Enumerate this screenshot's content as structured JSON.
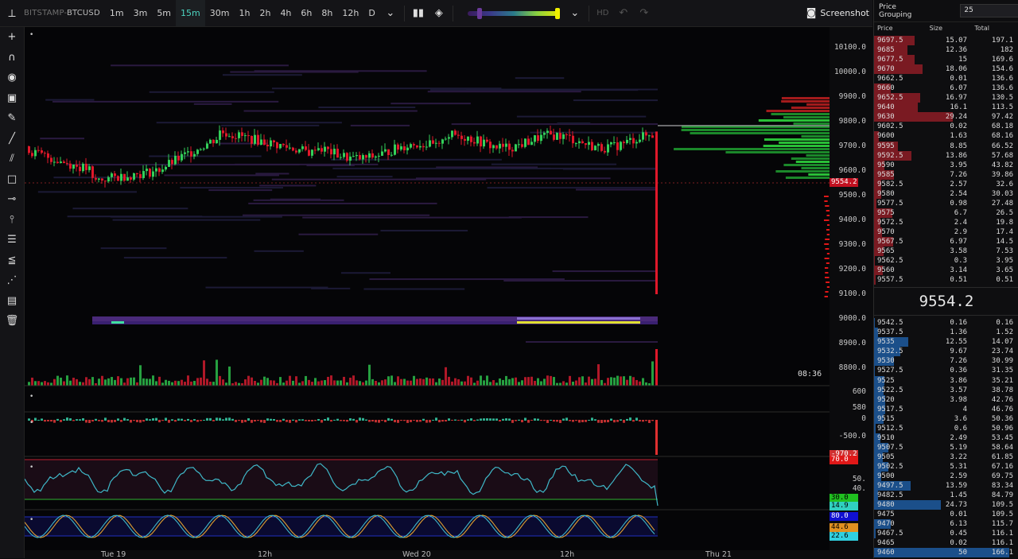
{
  "topbar": {
    "exchange": "BITSTAMP-",
    "pair": "BTCUSD",
    "timeframes": [
      "1m",
      "3m",
      "5m",
      "15m",
      "30m",
      "1h",
      "2h",
      "4h",
      "6h",
      "8h",
      "12h",
      "D"
    ],
    "active_timeframe": "15m",
    "hd_label": "HD",
    "screenshot_label": "Screenshot"
  },
  "price_axis": {
    "labels": [
      "10100.0",
      "10000.0",
      "9900.0",
      "9800.0",
      "9700.0",
      "9600.0",
      "9500.0",
      "9400.0",
      "9300.0",
      "9200.0",
      "9100.0",
      "9000.0",
      "8900.0",
      "8800.0"
    ],
    "current_price_tag": "9554.2"
  },
  "volume_axis": {
    "labels": [
      "600",
      "580"
    ]
  },
  "delta_axis": {
    "labels": [
      "0",
      "-500.0"
    ],
    "tag": "-970.2"
  },
  "rsi": {
    "labels": [
      "50.",
      "40."
    ],
    "upper": "70.0",
    "lower": "30.0",
    "value": "14.9"
  },
  "stoch": {
    "upper": "80.0",
    "k": "44.6",
    "d": "22.6"
  },
  "countdown": "08:36",
  "time_axis": [
    "Tue 19",
    "12h",
    "Wed 20",
    "12h",
    "Thu 21"
  ],
  "orderbook": {
    "grouping_label": "Price Grouping",
    "grouping_value": "25",
    "columns": [
      "Price",
      "Size",
      "Total"
    ],
    "mid_price": "9554.2",
    "asks": [
      {
        "price": "9697.5",
        "size": "15.07",
        "total": "197.1"
      },
      {
        "price": "9685",
        "size": "12.36",
        "total": "182"
      },
      {
        "price": "9677.5",
        "size": "15",
        "total": "169.6"
      },
      {
        "price": "9670",
        "size": "18.06",
        "total": "154.6"
      },
      {
        "price": "9662.5",
        "size": "0.01",
        "total": "136.6"
      },
      {
        "price": "9660",
        "size": "6.07",
        "total": "136.6"
      },
      {
        "price": "9652.5",
        "size": "16.97",
        "total": "130.5"
      },
      {
        "price": "9640",
        "size": "16.1",
        "total": "113.5"
      },
      {
        "price": "9630",
        "size": "29.24",
        "total": "97.42"
      },
      {
        "price": "9602.5",
        "size": "0.02",
        "total": "68.18"
      },
      {
        "price": "9600",
        "size": "1.63",
        "total": "68.16"
      },
      {
        "price": "9595",
        "size": "8.85",
        "total": "66.52"
      },
      {
        "price": "9592.5",
        "size": "13.86",
        "total": "57.68"
      },
      {
        "price": "9590",
        "size": "3.95",
        "total": "43.82"
      },
      {
        "price": "9585",
        "size": "7.26",
        "total": "39.86"
      },
      {
        "price": "9582.5",
        "size": "2.57",
        "total": "32.6"
      },
      {
        "price": "9580",
        "size": "2.54",
        "total": "30.03"
      },
      {
        "price": "9577.5",
        "size": "0.98",
        "total": "27.48"
      },
      {
        "price": "9575",
        "size": "6.7",
        "total": "26.5"
      },
      {
        "price": "9572.5",
        "size": "2.4",
        "total": "19.8"
      },
      {
        "price": "9570",
        "size": "2.9",
        "total": "17.4"
      },
      {
        "price": "9567.5",
        "size": "6.97",
        "total": "14.5"
      },
      {
        "price": "9565",
        "size": "3.58",
        "total": "7.53"
      },
      {
        "price": "9562.5",
        "size": "0.3",
        "total": "3.95"
      },
      {
        "price": "9560",
        "size": "3.14",
        "total": "3.65"
      },
      {
        "price": "9557.5",
        "size": "0.51",
        "total": "0.51"
      }
    ],
    "bids": [
      {
        "price": "9542.5",
        "size": "0.16",
        "total": "0.16"
      },
      {
        "price": "9537.5",
        "size": "1.36",
        "total": "1.52"
      },
      {
        "price": "9535",
        "size": "12.55",
        "total": "14.07"
      },
      {
        "price": "9532.5",
        "size": "9.67",
        "total": "23.74"
      },
      {
        "price": "9530",
        "size": "7.26",
        "total": "30.99"
      },
      {
        "price": "9527.5",
        "size": "0.36",
        "total": "31.35"
      },
      {
        "price": "9525",
        "size": "3.86",
        "total": "35.21"
      },
      {
        "price": "9522.5",
        "size": "3.57",
        "total": "38.78"
      },
      {
        "price": "9520",
        "size": "3.98",
        "total": "42.76"
      },
      {
        "price": "9517.5",
        "size": "4",
        "total": "46.76"
      },
      {
        "price": "9515",
        "size": "3.6",
        "total": "50.36"
      },
      {
        "price": "9512.5",
        "size": "0.6",
        "total": "50.96"
      },
      {
        "price": "9510",
        "size": "2.49",
        "total": "53.45"
      },
      {
        "price": "9507.5",
        "size": "5.19",
        "total": "58.64"
      },
      {
        "price": "9505",
        "size": "3.22",
        "total": "61.85"
      },
      {
        "price": "9502.5",
        "size": "5.31",
        "total": "67.16"
      },
      {
        "price": "9500",
        "size": "2.59",
        "total": "69.75"
      },
      {
        "price": "9497.5",
        "size": "13.59",
        "total": "83.34"
      },
      {
        "price": "9482.5",
        "size": "1.45",
        "total": "84.79"
      },
      {
        "price": "9480",
        "size": "24.73",
        "total": "109.5"
      },
      {
        "price": "9475",
        "size": "0.01",
        "total": "109.5"
      },
      {
        "price": "9470",
        "size": "6.13",
        "total": "115.7"
      },
      {
        "price": "9467.5",
        "size": "0.45",
        "total": "116.1"
      },
      {
        "price": "9465",
        "size": "0.02",
        "total": "116.1"
      },
      {
        "price": "9460",
        "size": "50",
        "total": "166.1"
      }
    ]
  },
  "colors": {
    "up": "#33d05a",
    "down": "#e0182a",
    "ask_bar": "#7a1a22",
    "bid_bar": "#1b4f8a",
    "accent": "#4cd4c0"
  }
}
